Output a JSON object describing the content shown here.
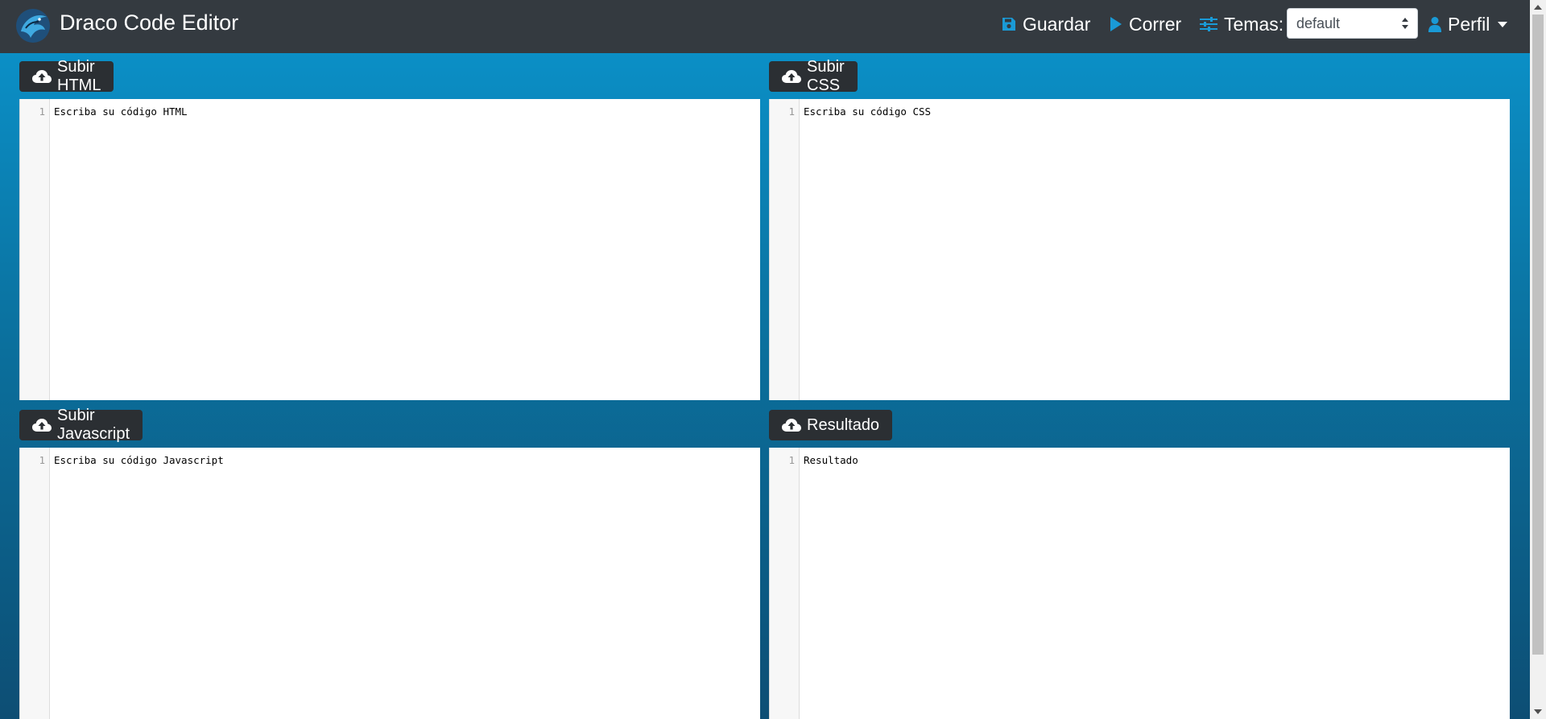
{
  "app": {
    "title": "Draco Code Editor"
  },
  "nav": {
    "save_label": "Guardar",
    "run_label": "Correr",
    "themes_label": "Temas:",
    "theme_selected": "default",
    "profile_label": "Perfil"
  },
  "panels": {
    "html": {
      "button_label": "Subir HTML",
      "line_number": "1",
      "code": "Escriba su código HTML"
    },
    "css": {
      "button_label": "Subir CSS",
      "line_number": "1",
      "code": "Escriba su código CSS"
    },
    "js": {
      "button_label": "Subir Javascript",
      "line_number": "1",
      "code": "Escriba su código Javascript"
    },
    "result": {
      "button_label": "Resultado",
      "line_number": "1",
      "code": "Resultado"
    }
  },
  "icons": {
    "brand": "dragon-logo-icon",
    "save": "floppy-disk-icon",
    "run": "play-icon",
    "themes": "sliders-icon",
    "profile": "user-icon",
    "upload": "cloud-upload-icon"
  },
  "colors": {
    "navbar": "#343a40",
    "accent": "#0d93d1",
    "gradient_top": "#0b8fc6",
    "gradient_bottom": "#0d4e74",
    "panel_button": "#2b2f33"
  }
}
